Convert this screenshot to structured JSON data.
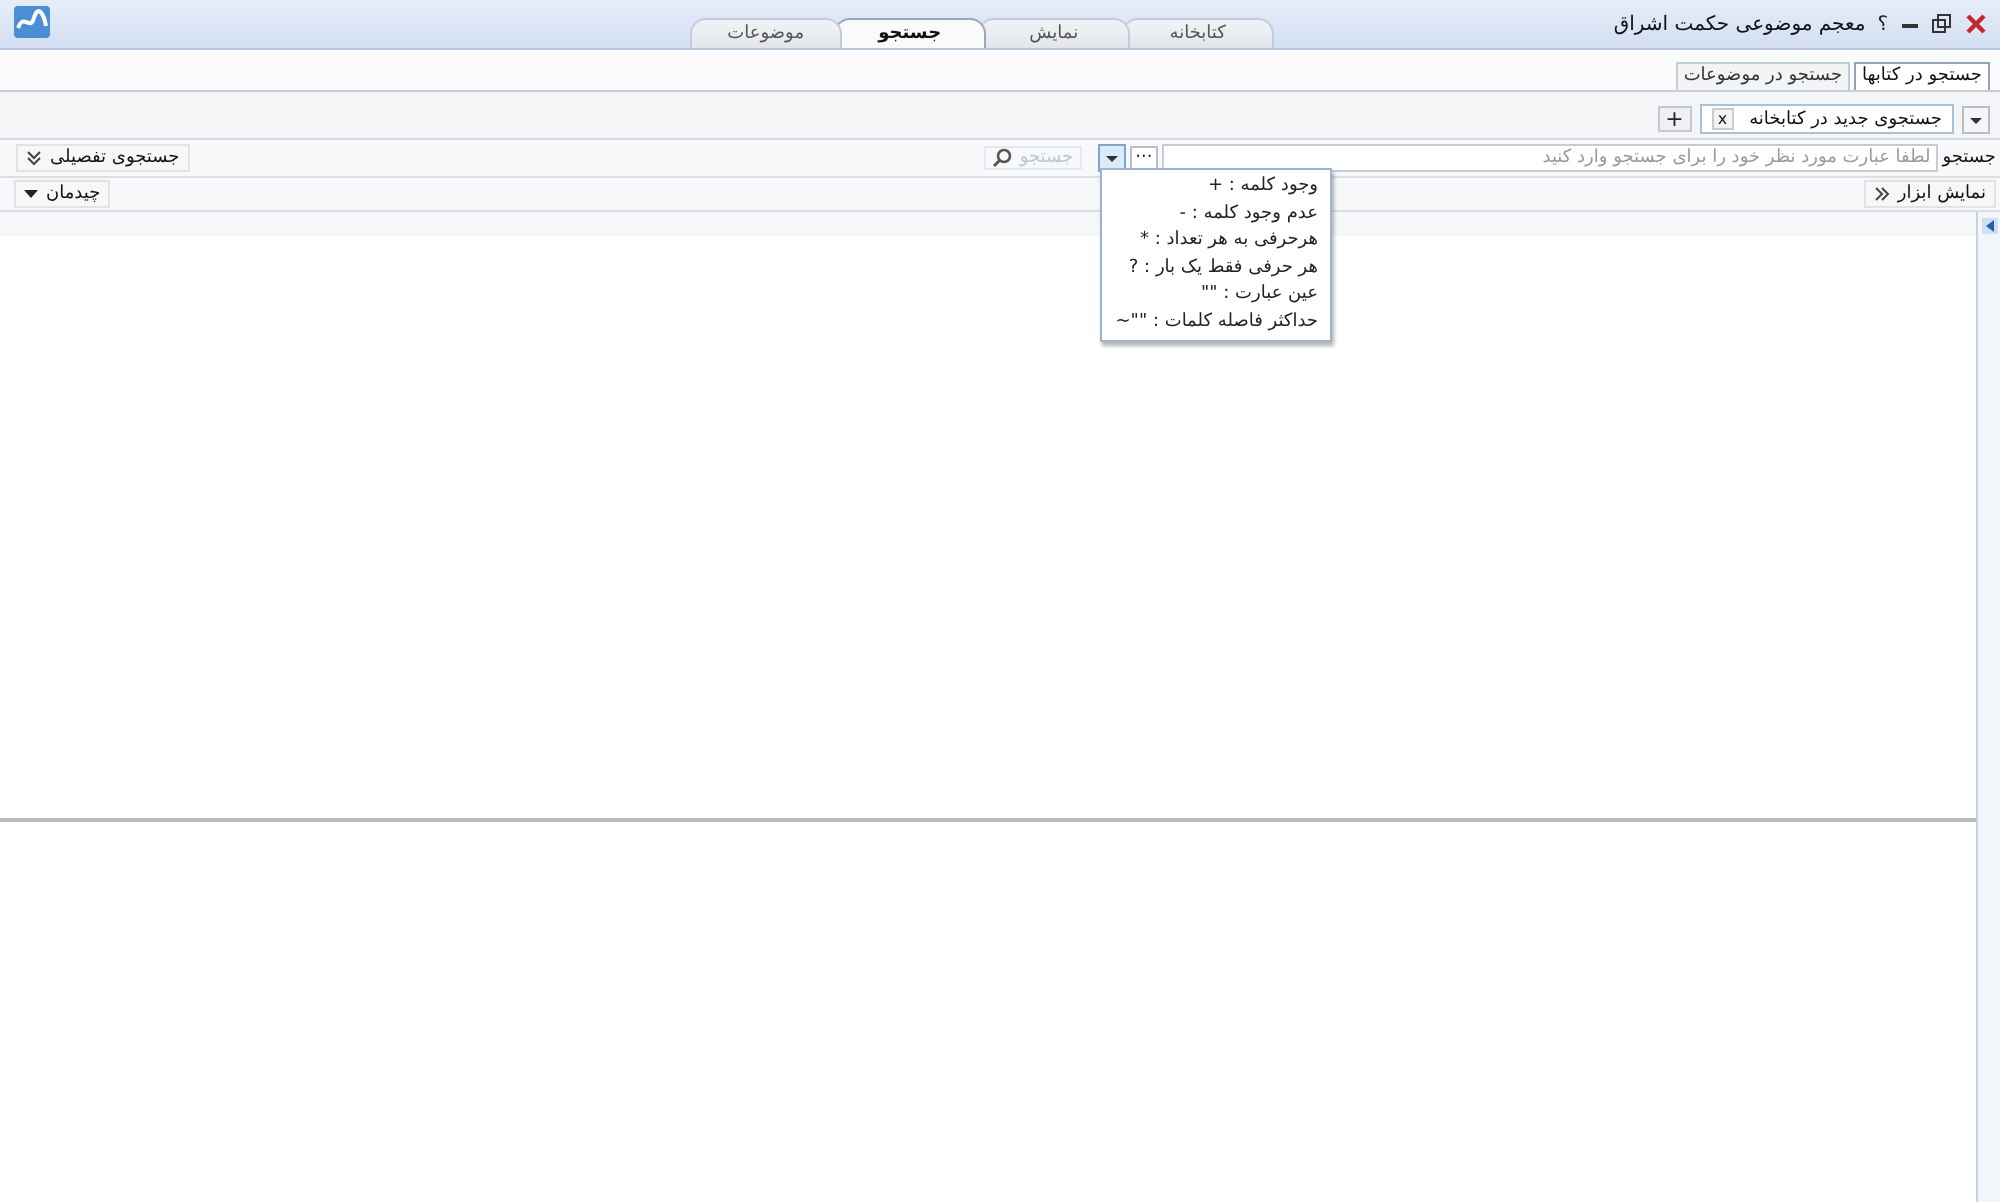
{
  "window": {
    "title": "معجم موضوعی حکمت اشراق",
    "help": "؟"
  },
  "main_tabs": [
    {
      "label": "کتابخانه",
      "selected": false
    },
    {
      "label": "نمایش",
      "selected": false
    },
    {
      "label": "جستجو",
      "selected": true
    },
    {
      "label": "موضوعات",
      "selected": false
    }
  ],
  "sub_tabs": [
    {
      "label": "جستجو در کتابها",
      "selected": true
    },
    {
      "label": "جستجو در موضوعات",
      "selected": false
    }
  ],
  "doc_tabs": [
    {
      "label": "جستجوی جدید در کتابخانه",
      "close": "x",
      "selected": true
    }
  ],
  "add_tab": "+",
  "search": {
    "label": "جستجو",
    "placeholder": "لطفا عبارت مورد نظر خود را برای جستجو وارد کنید",
    "more": "···",
    "button": "جستجو",
    "advanced": "جستجوی تفصیلی"
  },
  "operators_menu": [
    "وجود کلمه : +",
    "عدم وجود کلمه : -",
    "هرحرفی به هر تعداد : *",
    "هر حرفی فقط یک بار : ?",
    "عین عبارت : \"\"",
    "حداکثر فاصله کلمات : \"\"~"
  ],
  "toolbar": {
    "show_tools": "نمایش ابزار",
    "layout": "چیدمان"
  }
}
